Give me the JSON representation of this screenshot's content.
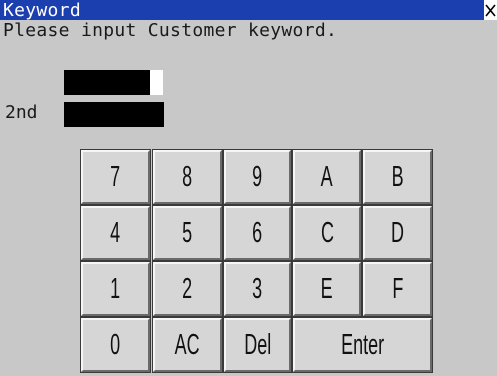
{
  "window": {
    "title": "Keyword",
    "close_icon": "close-icon"
  },
  "prompt": "Please input Customer keyword.",
  "second_label": "2nd",
  "keypad": {
    "row1": [
      "7",
      "8",
      "9",
      "A",
      "B"
    ],
    "row2": [
      "4",
      "5",
      "6",
      "C",
      "D"
    ],
    "row3": [
      "1",
      "2",
      "3",
      "E",
      "F"
    ],
    "row4": [
      "0",
      "AC",
      "Del",
      "Enter"
    ]
  },
  "colors": {
    "titlebar": "#1c3fb0",
    "background": "#c8c8c8",
    "key": "#d6d6d6",
    "field": "#000000"
  }
}
